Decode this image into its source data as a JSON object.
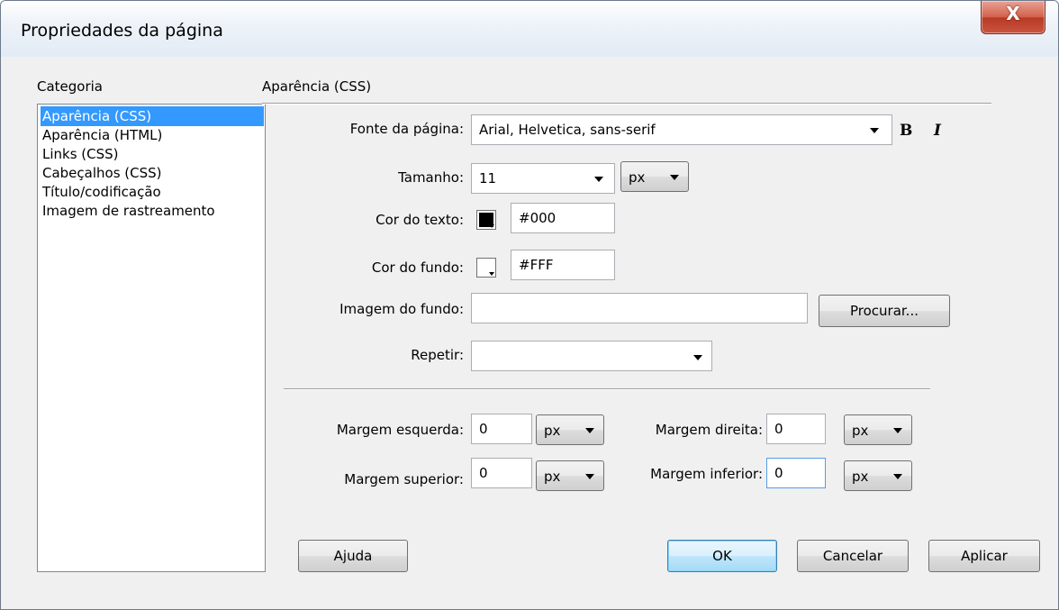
{
  "window": {
    "title": "Propriedades da página",
    "close_glyph": "X"
  },
  "sidebar": {
    "header": "Categoria",
    "items": [
      {
        "label": "Aparência (CSS)",
        "selected": true
      },
      {
        "label": "Aparência (HTML)",
        "selected": false
      },
      {
        "label": "Links (CSS)",
        "selected": false
      },
      {
        "label": "Cabeçalhos (CSS)",
        "selected": false
      },
      {
        "label": "Título/codificação",
        "selected": false
      },
      {
        "label": "Imagem de rastreamento",
        "selected": false
      }
    ]
  },
  "panel": {
    "title": "Aparência (CSS)",
    "font": {
      "label": "Fonte da página:",
      "value": "Arial, Helvetica, sans-serif",
      "bold_glyph": "B",
      "italic_glyph": "I"
    },
    "size": {
      "label": "Tamanho:",
      "value": "11",
      "unit": "px"
    },
    "text_color": {
      "label": "Cor do texto:",
      "value": "#000",
      "swatch": "#000000"
    },
    "bg_color": {
      "label": "Cor do fundo:",
      "value": "#FFF",
      "swatch": "#ffffff"
    },
    "bg_image": {
      "label": "Imagem do fundo:",
      "value": "",
      "browse": "Procurar..."
    },
    "repeat": {
      "label": "Repetir:",
      "value": ""
    },
    "margins": {
      "left": {
        "label": "Margem esquerda:",
        "value": "0",
        "unit": "px"
      },
      "right": {
        "label": "Margem direita:",
        "value": "0",
        "unit": "px"
      },
      "top": {
        "label": "Margem superior:",
        "value": "0",
        "unit": "px"
      },
      "bottom": {
        "label": "Margem inferior:",
        "value": "0",
        "unit": "px"
      }
    }
  },
  "buttons": {
    "help": "Ajuda",
    "ok": "OK",
    "cancel": "Cancelar",
    "apply": "Aplicar"
  }
}
